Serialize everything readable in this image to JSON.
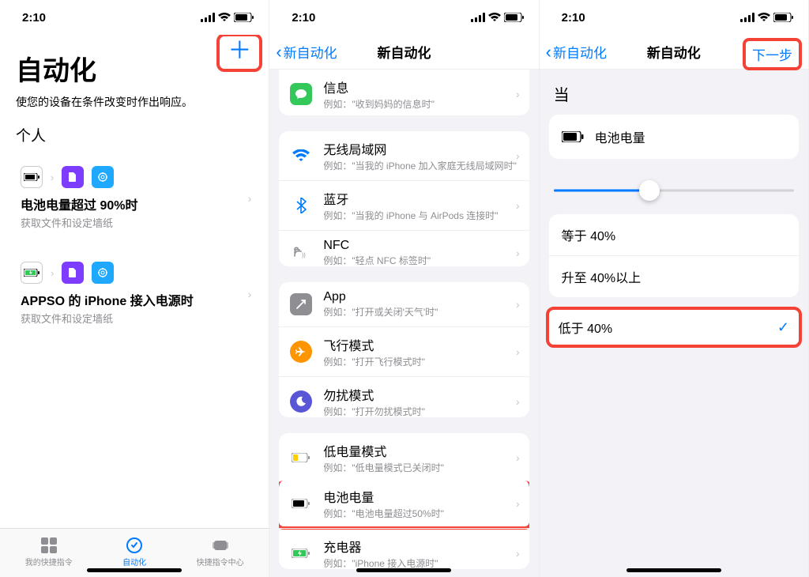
{
  "status": {
    "time": "2:10"
  },
  "screen1": {
    "title": "自动化",
    "subtitle": "使您的设备在条件改变时作出响应。",
    "section_label": "个人",
    "add_glyph": "＋",
    "automations": [
      {
        "title": "电池电量超过 90%时",
        "sub": "获取文件和设定墙纸"
      },
      {
        "title": "APPSO 的 iPhone 接入电源时",
        "sub": "获取文件和设定墙纸"
      }
    ],
    "tabs": {
      "my": "我的快捷指令",
      "auto": "自动化",
      "gallery": "快捷指令中心"
    }
  },
  "screen2": {
    "nav_title": "新自动化",
    "back": "新自动化",
    "rows": [
      {
        "title": "信息",
        "sub": "例如：\"收到妈妈的信息时\"",
        "icon": "message",
        "color": "#34c759"
      },
      {
        "title": "无线局域网",
        "sub": "例如：\"当我的 iPhone 加入家庭无线局域网时\"",
        "icon": "wifi",
        "color": "plain"
      },
      {
        "title": "蓝牙",
        "sub": "例如：\"当我的 iPhone 与 AirPods 连接时\"",
        "icon": "bluetooth",
        "color": "plain"
      },
      {
        "title": "NFC",
        "sub": "例如：\"轻点 NFC 标签时\"",
        "icon": "nfc",
        "color": "plain"
      },
      {
        "title": "App",
        "sub": "例如：\"打开或关闭'天气'时\"",
        "icon": "app",
        "color": "#8e8e93"
      },
      {
        "title": "飞行模式",
        "sub": "例如：\"打开飞行模式时\"",
        "icon": "airplane",
        "color": "#ff9500"
      },
      {
        "title": "勿扰模式",
        "sub": "例如：\"打开勿扰模式时\"",
        "icon": "dnd",
        "color": "#5856d6"
      },
      {
        "title": "低电量模式",
        "sub": "例如：\"低电量模式已关闭时\"",
        "icon": "lowbatt",
        "color": "plain"
      },
      {
        "title": "电池电量",
        "sub": "例如：\"电池电量超过50%时\"",
        "icon": "battery",
        "color": "plain"
      },
      {
        "title": "充电器",
        "sub": "例如：\"iPhone 接入电源时\"",
        "icon": "charger",
        "color": "plain"
      }
    ]
  },
  "screen3": {
    "nav_title": "新自动化",
    "back": "新自动化",
    "next": "下一步",
    "when_label": "当",
    "item": "电池电量",
    "slider_percent": 40,
    "options": [
      {
        "label": "等于 40%"
      },
      {
        "label": "升至 40%以上"
      },
      {
        "label": "低于 40%",
        "checked": true,
        "highlight": true
      }
    ]
  }
}
